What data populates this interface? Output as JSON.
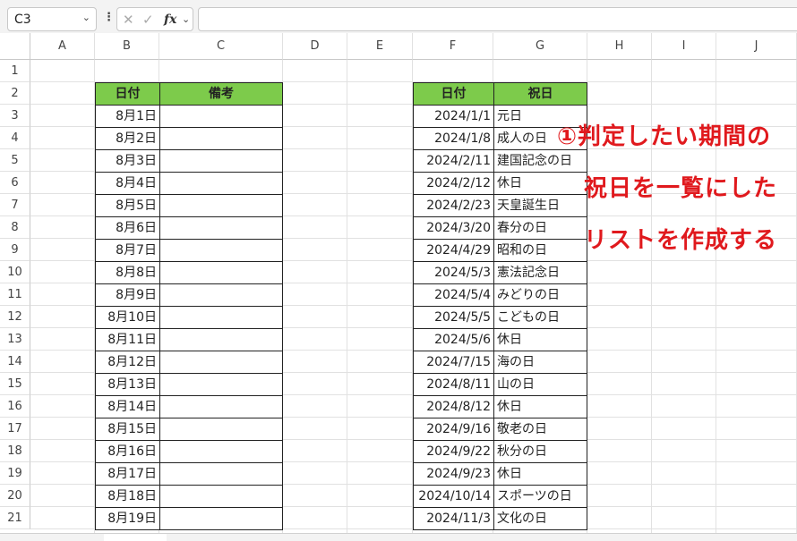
{
  "formula_bar": {
    "name_box": "C3",
    "formula": ""
  },
  "columns": [
    "A",
    "B",
    "C",
    "D",
    "E",
    "F",
    "G",
    "H",
    "I",
    "J"
  ],
  "rows": [
    "1",
    "2",
    "3",
    "4",
    "5",
    "6",
    "7",
    "8",
    "9",
    "10",
    "11",
    "12",
    "13",
    "14",
    "15",
    "16",
    "17",
    "18",
    "19",
    "20",
    "21"
  ],
  "left_table": {
    "headers": [
      "日付",
      "備考"
    ],
    "dates": [
      "8月1日",
      "8月2日",
      "8月3日",
      "8月4日",
      "8月5日",
      "8月6日",
      "8月7日",
      "8月8日",
      "8月9日",
      "8月10日",
      "8月11日",
      "8月12日",
      "8月13日",
      "8月14日",
      "8月15日",
      "8月16日",
      "8月17日",
      "8月18日",
      "8月19日"
    ]
  },
  "holiday_table": {
    "headers": [
      "日付",
      "祝日"
    ],
    "rows": [
      {
        "date": "2024/1/1",
        "name": "元日"
      },
      {
        "date": "2024/1/8",
        "name": "成人の日"
      },
      {
        "date": "2024/2/11",
        "name": "建国記念の日"
      },
      {
        "date": "2024/2/12",
        "name": "休日"
      },
      {
        "date": "2024/2/23",
        "name": "天皇誕生日"
      },
      {
        "date": "2024/3/20",
        "name": "春分の日"
      },
      {
        "date": "2024/4/29",
        "name": "昭和の日"
      },
      {
        "date": "2024/5/3",
        "name": "憲法記念日"
      },
      {
        "date": "2024/5/4",
        "name": "みどりの日"
      },
      {
        "date": "2024/5/5",
        "name": "こどもの日"
      },
      {
        "date": "2024/5/6",
        "name": "休日"
      },
      {
        "date": "2024/7/15",
        "name": "海の日"
      },
      {
        "date": "2024/8/11",
        "name": "山の日"
      },
      {
        "date": "2024/8/12",
        "name": "休日"
      },
      {
        "date": "2024/9/16",
        "name": "敬老の日"
      },
      {
        "date": "2024/9/22",
        "name": "秋分の日"
      },
      {
        "date": "2024/9/23",
        "name": "休日"
      },
      {
        "date": "2024/10/14",
        "name": "スポーツの日"
      },
      {
        "date": "2024/11/3",
        "name": "文化の日"
      }
    ]
  },
  "annotation": {
    "line1": "①判定したい期間の",
    "line2": "祝日を一覧にした",
    "line3": "リストを作成する",
    "color": "#e0191d"
  },
  "header_fill": "#7dcb4b"
}
